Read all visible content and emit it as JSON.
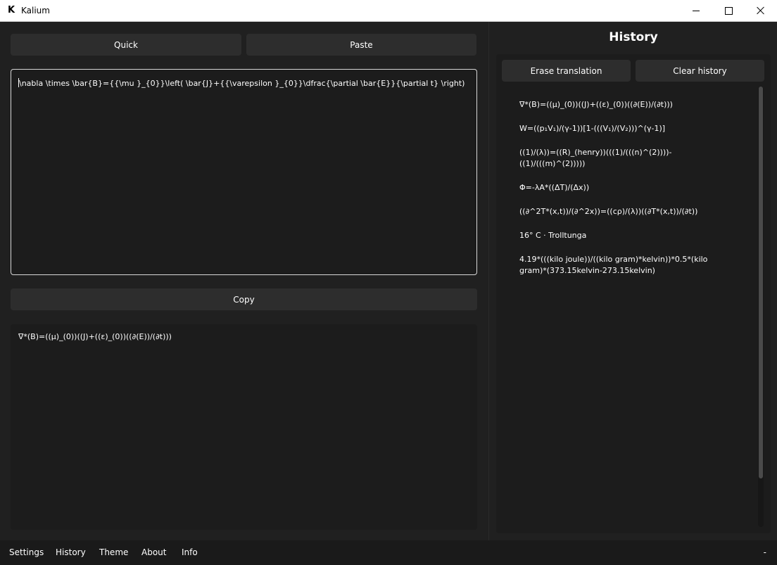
{
  "window": {
    "logo": "K",
    "title": "Kalium"
  },
  "toolbar": {
    "quick_label": "Quick",
    "paste_label": "Paste",
    "copy_label": "Copy"
  },
  "input": {
    "value": "\\nabla \\times \\bar{B}={{\\mu }_{0}}\\left( \\bar{J}+{{\\varepsilon }_{0}}\\dfrac{\\partial \\bar{E}}{\\partial t} \\right)"
  },
  "output": {
    "value": "∇*(B)=((μ)_(0))((J)+((ε)_(0))((∂(E))/(∂t)))"
  },
  "history": {
    "title": "History",
    "erase_label": "Erase translation",
    "clear_label": "Clear history",
    "items": [
      "∇*(B)=((μ)_(0))((J)+((ε)_(0))((∂(E))/(∂t)))",
      "W=((p₁V₁)/(γ-1))[1-(((V₁)/(V₂)))^(γ-1)]",
      "((1)/(λ))=((R)_(henry))(((1)/(((n)^(2))))-((1)/(((m)^(2)))))",
      "Φ=-λA*((ΔT)/(Δx))",
      "((∂^2T*(x,t))/(∂^2x))=((cρ)/(λ))((∂T*(x,t))/(∂t))",
      "16° C · Trolltunga",
      "4.19*(((kilo joule))/((kilo gram)*kelvin))*0.5*(kilo gram)*(373.15kelvin-273.15kelvin)"
    ]
  },
  "nav": {
    "settings": "Settings",
    "history": "History",
    "theme": "Theme",
    "about": "About",
    "info": "Info",
    "status": "-"
  }
}
